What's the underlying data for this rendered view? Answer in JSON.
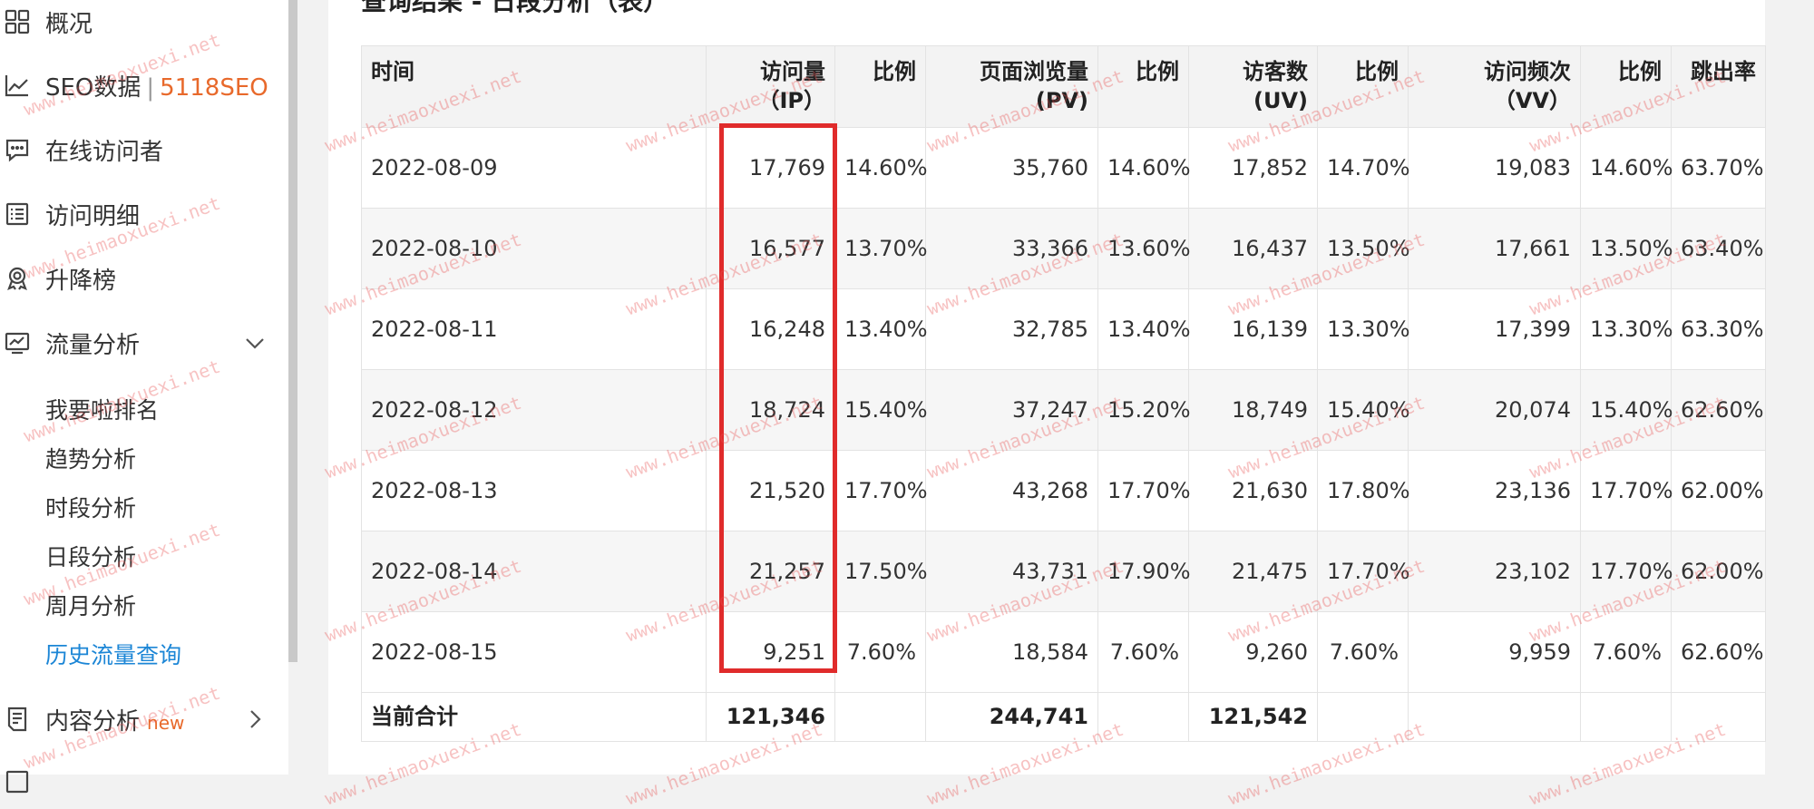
{
  "sidebar": {
    "items": [
      {
        "label": "概况",
        "icon": "grid-icon"
      },
      {
        "label": "SEO数据",
        "separator": "|",
        "brand": "5118SEO",
        "icon": "line-chart-icon"
      },
      {
        "label": "在线访问者",
        "icon": "chat-icon"
      },
      {
        "label": "访问明细",
        "icon": "list-icon"
      },
      {
        "label": "升降榜",
        "icon": "award-icon"
      },
      {
        "label": "流量分析",
        "icon": "monitor-chart-icon",
        "expanded": true
      },
      {
        "label": "内容分析",
        "badge": "new",
        "icon": "document-icon"
      }
    ],
    "traffic_sub_items": [
      "我要啦排名",
      "趋势分析",
      "时段分析",
      "日段分析",
      "周月分析",
      "历史流量查询"
    ],
    "active_sub_item": "历史流量查询",
    "accent_color": "#1c86d6",
    "brand_color": "#e8692b"
  },
  "main": {
    "title": "查询结果 - 日段分析（表）",
    "table": {
      "headers": [
        "时间",
        "访问量（IP）",
        "比例",
        "页面浏览量(PV)",
        "比例",
        "访客数(UV)",
        "比例",
        "访问频次（VV）",
        "比例",
        "跳出率"
      ],
      "rows": [
        [
          "2022-08-09",
          "17,769",
          "14.60%",
          "35,760",
          "14.60%",
          "17,852",
          "14.70%",
          "19,083",
          "14.60%",
          "63.70%"
        ],
        [
          "2022-08-10",
          "16,577",
          "13.70%",
          "33,366",
          "13.60%",
          "16,437",
          "13.50%",
          "17,661",
          "13.50%",
          "63.40%"
        ],
        [
          "2022-08-11",
          "16,248",
          "13.40%",
          "32,785",
          "13.40%",
          "16,139",
          "13.30%",
          "17,399",
          "13.30%",
          "63.30%"
        ],
        [
          "2022-08-12",
          "18,724",
          "15.40%",
          "37,247",
          "15.20%",
          "18,749",
          "15.40%",
          "20,074",
          "15.40%",
          "62.60%"
        ],
        [
          "2022-08-13",
          "21,520",
          "17.70%",
          "43,268",
          "17.70%",
          "21,630",
          "17.80%",
          "23,136",
          "17.70%",
          "62.00%"
        ],
        [
          "2022-08-14",
          "21,257",
          "17.50%",
          "43,731",
          "17.90%",
          "21,475",
          "17.70%",
          "23,102",
          "17.70%",
          "62.00%"
        ],
        [
          "2022-08-15",
          "9,251",
          "7.60%",
          "18,584",
          "7.60%",
          "9,260",
          "7.60%",
          "9,959",
          "7.60%",
          "62.60%"
        ]
      ],
      "total": [
        "当前合计",
        "121,346",
        "",
        "244,741",
        "",
        "121,542",
        "",
        "",
        "",
        ""
      ]
    },
    "highlight_color": "#e02b2b"
  },
  "watermark": "www.heimaoxuexi.net"
}
